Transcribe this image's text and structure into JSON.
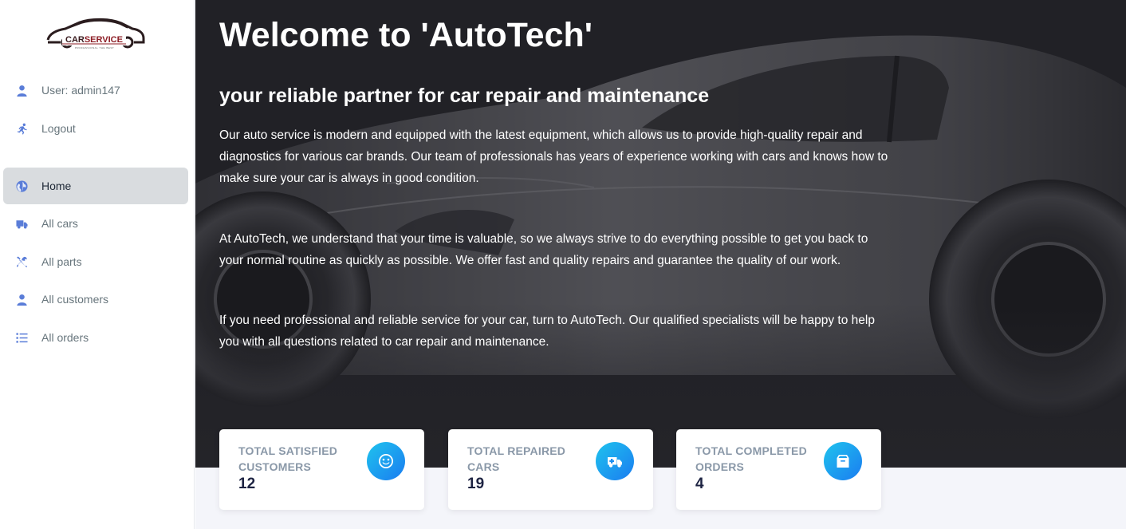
{
  "logo": {
    "text_dark": "CAR",
    "text_red": "SERVICE",
    "tagline": "PROFESSIONAL THE BEST"
  },
  "sidebar": {
    "user_label": "User: admin147",
    "logout_label": "Logout",
    "items": [
      {
        "label": "Home",
        "icon": "globe-icon",
        "active": true
      },
      {
        "label": "All cars",
        "icon": "truck-icon"
      },
      {
        "label": "All parts",
        "icon": "tools-icon"
      },
      {
        "label": "All customers",
        "icon": "user-icon"
      },
      {
        "label": "All orders",
        "icon": "list-icon"
      }
    ]
  },
  "hero": {
    "title": "Welcome to 'AutoTech'",
    "subtitle": "your reliable partner for car repair and maintenance",
    "paragraphs": [
      "Our auto service is modern and equipped with the latest equipment, which allows us to provide high-quality repair and diagnostics for various car brands. Our team of professionals has years of experience working with cars and knows how to make sure your car is always in good condition.",
      "At AutoTech, we understand that your time is valuable, so we always strive to do everything possible to get you back to your normal routine as quickly as possible. We offer fast and quality repairs and guarantee the quality of our work.",
      "If you need professional and reliable service for your car, turn to AutoTech. Our qualified specialists will be happy to help you with all questions related to car repair and maintenance."
    ]
  },
  "stats": [
    {
      "label": "TOTAL SATISFIED CUSTOMERS",
      "value": "12",
      "icon": "smile-icon"
    },
    {
      "label": "TOTAL REPAIRED CARS",
      "value": "19",
      "icon": "truck-icon"
    },
    {
      "label": "TOTAL COMPLETED ORDERS",
      "value": "4",
      "icon": "bag-icon"
    }
  ],
  "colors": {
    "accent": "#5a7dd8",
    "hero_bg": "#242429",
    "stat_gradient_start": "#1fc3ee",
    "stat_gradient_end": "#1a7cf0"
  }
}
